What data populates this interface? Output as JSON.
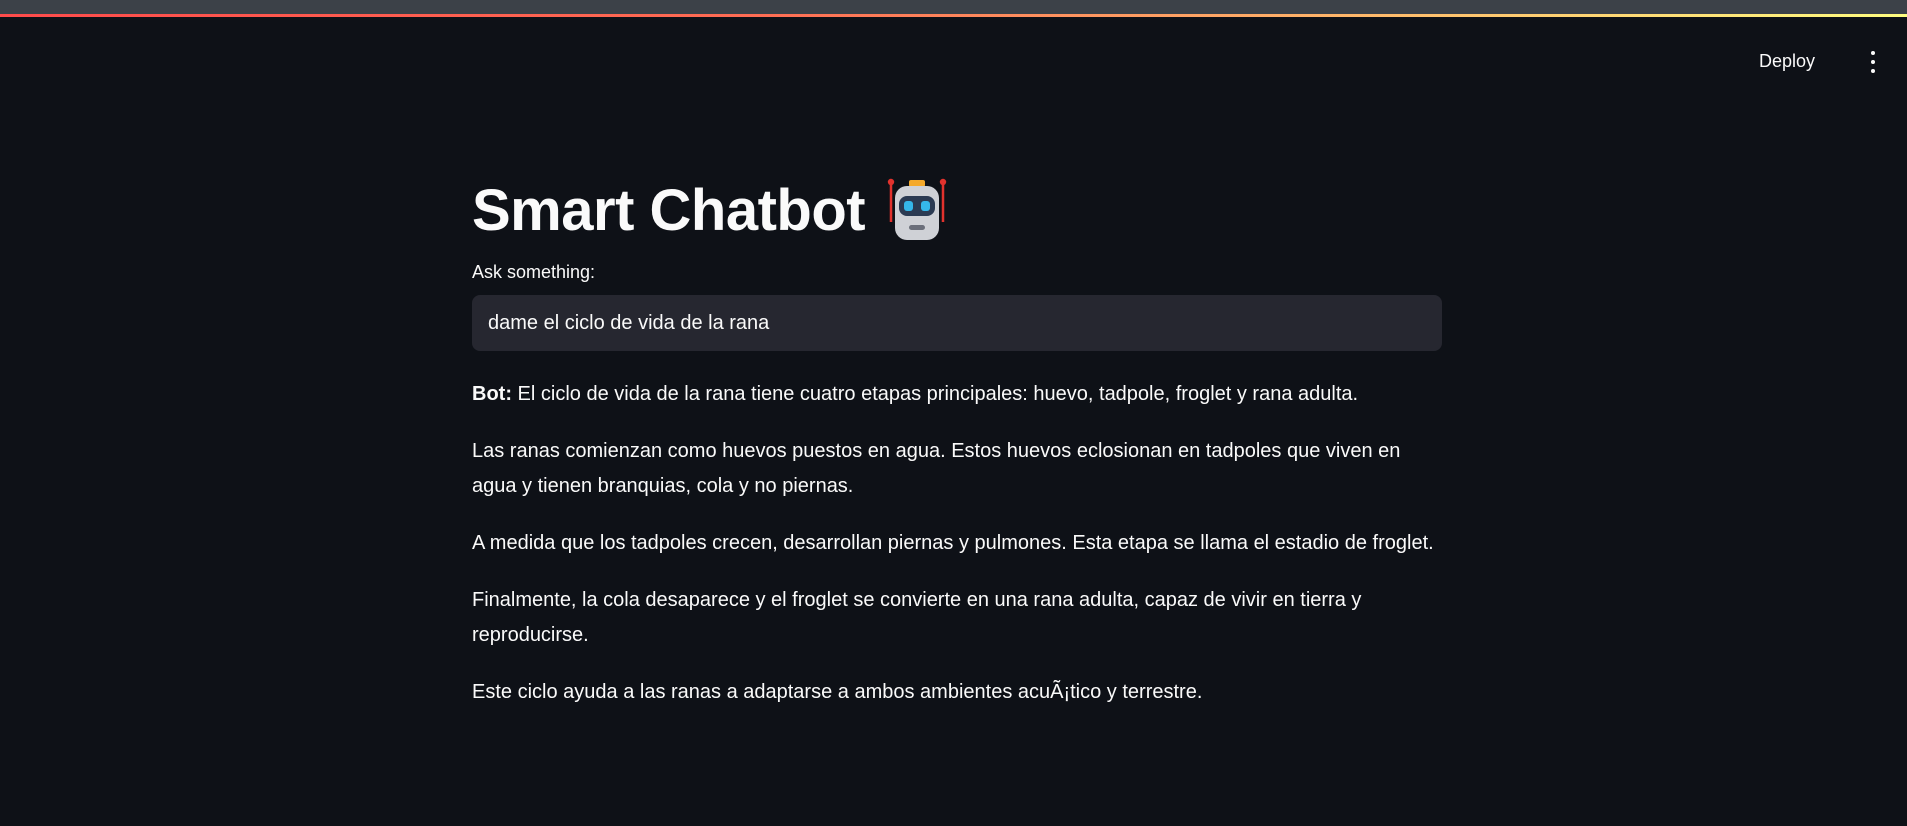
{
  "header": {
    "deploy_label": "Deploy",
    "menu_icon": "more-vertical-icon"
  },
  "main": {
    "title": "Smart Chatbot",
    "title_icon": "robot-emoji-icon",
    "input_label": "Ask something:",
    "input_value": "dame el ciclo de vida de la rana"
  },
  "response": {
    "bot_label": "Bot:",
    "first_paragraph": " El ciclo de vida de la rana tiene cuatro etapas principales: huevo, tadpole, froglet y rana adulta.",
    "paragraphs": [
      "Las ranas comienzan como huevos puestos en agua. Estos huevos eclosionan en tadpoles que viven en agua y tienen branquias, cola y no piernas.",
      "A medida que los tadpoles crecen, desarrollan piernas y pulmones. Esta etapa se llama el estadio de froglet.",
      "Finalmente, la cola desaparece y el froglet se convierte en una rana adulta, capaz de vivir en tierra y reproducirse.",
      "Este ciclo ayuda a las ranas a adaptarse a ambos ambientes acuÃ¡tico y terrestre."
    ]
  },
  "colors": {
    "background": "#0e1117",
    "input_background": "#262730",
    "text": "#fafafa",
    "accent_red": "#ff4b4b",
    "accent_yellow": "#fffd80"
  }
}
